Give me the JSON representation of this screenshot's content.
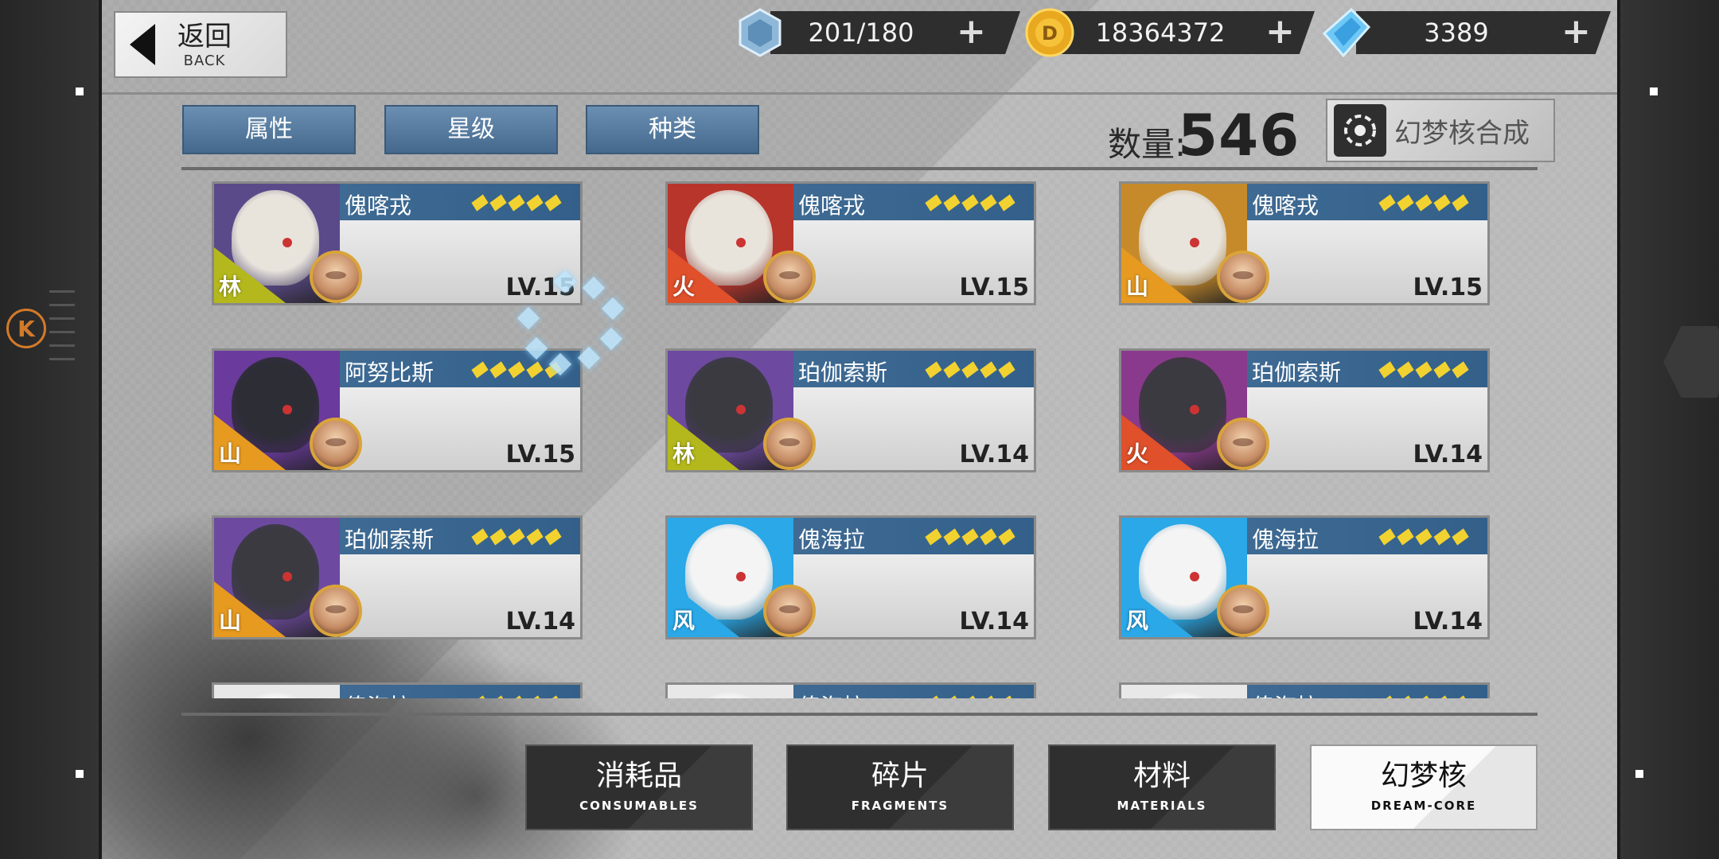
{
  "back": {
    "zh": "返回",
    "en": "BACK"
  },
  "resources": [
    {
      "icon": "stamina-crystal-icon",
      "value": "201/180"
    },
    {
      "icon": "gold-coin-icon",
      "value": "18364372"
    },
    {
      "icon": "blue-diamond-icon",
      "value": "3389"
    }
  ],
  "plus": "+",
  "filters": [
    "属性",
    "星级",
    "种类"
  ],
  "count": {
    "label": "数量:",
    "value": "546"
  },
  "synth": {
    "label": "幻梦核合成"
  },
  "side": {
    "k": "K"
  },
  "cards": [
    {
      "name": "傀喀戎",
      "level": "LV.15",
      "element": "林",
      "elem_color": "#b4b81c",
      "bg": "#5b4a8a",
      "art": "#e8e4dc",
      "stars": 5
    },
    {
      "name": "傀喀戎",
      "level": "LV.15",
      "element": "火",
      "elem_color": "#e0502a",
      "bg": "#b8352c",
      "art": "#e8e4dc",
      "stars": 5
    },
    {
      "name": "傀喀戎",
      "level": "LV.15",
      "element": "山",
      "elem_color": "#e69a20",
      "bg": "#c78a2a",
      "art": "#e8e4dc",
      "stars": 5
    },
    {
      "name": "阿努比斯",
      "level": "LV.15",
      "element": "山",
      "elem_color": "#e69a20",
      "bg": "#6a3a9c",
      "art": "#2d2d35",
      "stars": 5
    },
    {
      "name": "珀伽索斯",
      "level": "LV.14",
      "element": "林",
      "elem_color": "#b4b81c",
      "bg": "#6d4aa0",
      "art": "#3a3a40",
      "stars": 5
    },
    {
      "name": "珀伽索斯",
      "level": "LV.14",
      "element": "火",
      "elem_color": "#e0502a",
      "bg": "#8a3a8c",
      "art": "#3a3a40",
      "stars": 5
    },
    {
      "name": "珀伽索斯",
      "level": "LV.14",
      "element": "山",
      "elem_color": "#e69a20",
      "bg": "#6d4aa0",
      "art": "#3a3a40",
      "stars": 5
    },
    {
      "name": "傀海拉",
      "level": "LV.14",
      "element": "风",
      "elem_color": "#2aa8e8",
      "bg": "#2aa8e8",
      "art": "#f4f4f4",
      "stars": 5
    },
    {
      "name": "傀海拉",
      "level": "LV.14",
      "element": "风",
      "elem_color": "#2aa8e8",
      "bg": "#2aa8e8",
      "art": "#f4f4f4",
      "stars": 5
    },
    {
      "name": "傀海拉",
      "level": "",
      "element": "",
      "elem_color": "#b4b81c",
      "bg": "#e8e8e8",
      "art": "#f4f4f4",
      "stars": 5
    },
    {
      "name": "傀海拉",
      "level": "",
      "element": "",
      "elem_color": "#b4b81c",
      "bg": "#e8e8e8",
      "art": "#f4f4f4",
      "stars": 5
    },
    {
      "name": "傀海拉",
      "level": "",
      "element": "",
      "elem_color": "#e0502a",
      "bg": "#e8e8e8",
      "art": "#f4f4f4",
      "stars": 5
    }
  ],
  "tabs": [
    {
      "zh": "消耗品",
      "en": "CONSUMABLES",
      "active": false
    },
    {
      "zh": "碎片",
      "en": "FRAGMENTS",
      "active": false
    },
    {
      "zh": "材料",
      "en": "MATERIALS",
      "active": false
    },
    {
      "zh": "幻梦核",
      "en": "DREAM-CORE",
      "active": true
    }
  ]
}
